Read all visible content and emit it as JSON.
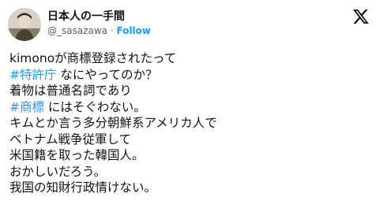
{
  "author": {
    "display_name": "日本人の一手間",
    "handle": "@_sasazawa",
    "separator": " · ",
    "follow_label": "Follow"
  },
  "tweet": {
    "line1": "kimonoが商標登録されたって",
    "line2_hashtag": "#特許庁",
    "line2_rest": " なにやってのか？",
    "line3": "着物は普通名詞であり",
    "line4_hashtag": "#商標",
    "line4_rest": " にはそぐわない。",
    "line5": "キムとか言う多分朝鮮系アメリカ人で",
    "line6": "ベトナム戦争従軍して",
    "line7": "米国籍を取った韓国人。",
    "line8": "おかしいだろう。",
    "line9": "我国の知財行政情けない。"
  },
  "icons": {
    "logo": "x-logo-icon",
    "avatar": "avatar-photo"
  },
  "colors": {
    "link": "#1d9bf0",
    "text": "#0f1419",
    "muted": "#536471"
  }
}
